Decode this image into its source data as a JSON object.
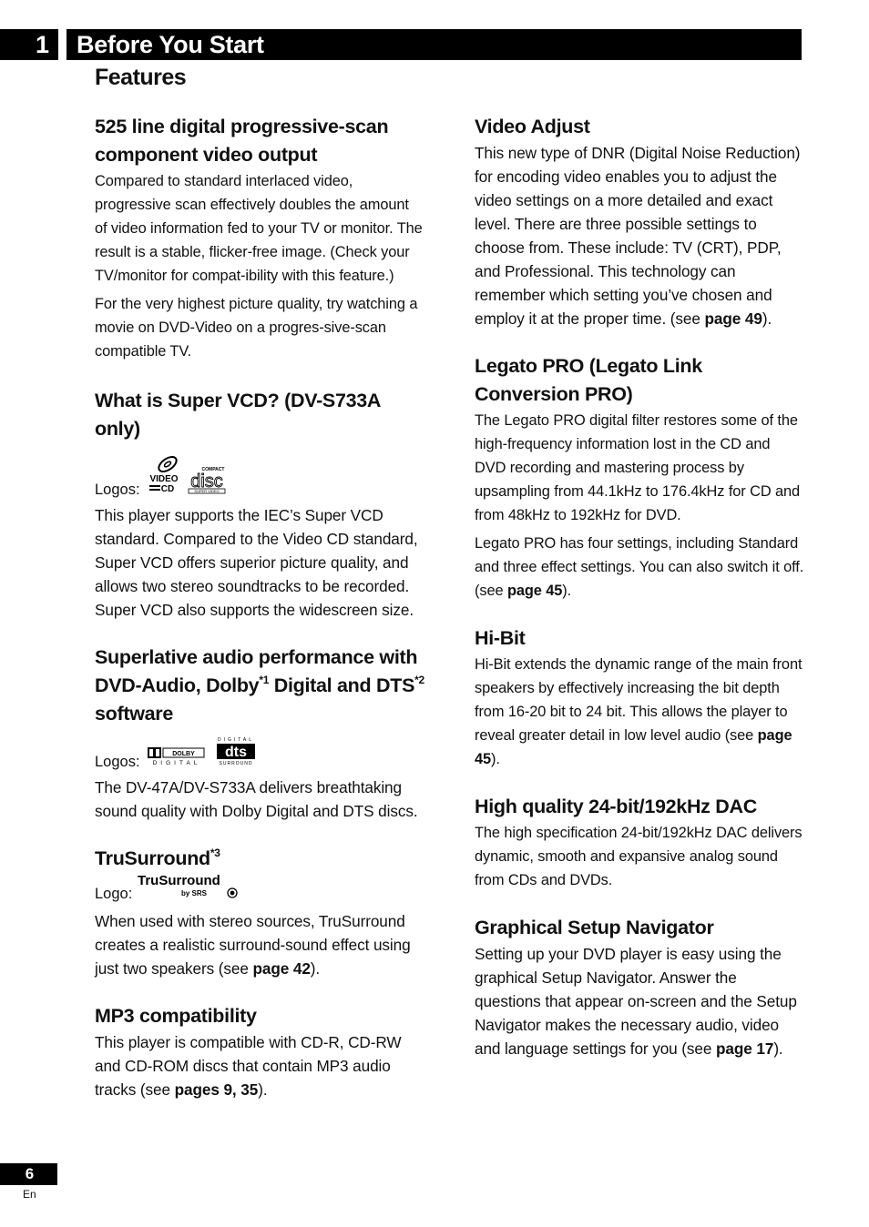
{
  "header": {
    "chapter_number": "1",
    "chapter_title": "Before You Start",
    "page_title": "Features"
  },
  "left_column": {
    "progressive": {
      "heading": "525 line digital progressive-scan component video output",
      "para1": "Compared to standard interlaced video, progressive scan effectively doubles the amount of video information fed to your TV or monitor. The result is a stable, flicker-free image. (Check your TV/monitor for compat-ibility with this feature.)",
      "para2": "For the very highest picture quality, try watching a movie on DVD-Video on a progres-sive-scan compatible TV."
    },
    "svcd": {
      "heading": "What is Super VCD? (DV-S733A only)",
      "logos_label": "Logos:",
      "logos": [
        "video-cd-logo",
        "compact-disc-super-video-logo"
      ],
      "body": "This player supports the IEC’s Super VCD standard.  Compared to the Video CD standard, Super VCD offers superior picture quality, and allows two stereo soundtracks to be recorded. Super VCD also supports the widescreen size."
    },
    "audio": {
      "heading_part1": "Superlative audio performance with DVD-Audio, Dolby",
      "heading_sup1": "*1",
      "heading_part2": " Digital and DTS",
      "heading_sup2": "*2",
      "heading_part3": " software",
      "logos_label": "Logos:",
      "logos": [
        "dolby-digital-logo",
        "dts-digital-surround-logo"
      ],
      "dolby_text": "DOLBY",
      "dolby_sub": "DIGITAL",
      "dts_top": "DIGITAL",
      "dts_mid": "dts",
      "dts_bottom": "SURROUND",
      "body": "The DV-47A/DV-S733A delivers breathtaking sound quality with Dolby Digital and DTS discs."
    },
    "trusurround": {
      "heading": "TruSurround",
      "heading_sup": "*3",
      "logo_label": "Logo:",
      "logo_main": "TruSurround",
      "logo_sub": "by SRS",
      "body_before": "When used with stereo sources, TruSurround creates a realistic surround-sound effect using just two speakers (see ",
      "body_ref": "page 42",
      "body_after": ")."
    },
    "mp3": {
      "heading": "MP3 compatibility",
      "body_before": "This player is compatible with CD-R, CD-RW and CD-ROM discs that contain MP3 audio tracks (see ",
      "body_ref": "pages 9, 35",
      "body_after": ")."
    }
  },
  "right_column": {
    "video_adjust": {
      "heading": "Video Adjust",
      "body_before": "This new type of DNR (Digital Noise Reduction) for encoding video enables you to adjust the video settings on a more detailed and exact level. There are three possible settings to choose from. These include: TV (CRT), PDP, and Professional. This technology can remember which setting you’ve chosen and employ it at the proper time. (see ",
      "body_ref": "page 49",
      "body_after": ")."
    },
    "legato": {
      "heading": "Legato PRO (Legato Link Conversion PRO)",
      "para1": "The Legato PRO digital filter restores some of the high-frequency information lost in the CD and DVD recording and mastering process by upsampling from 44.1kHz to 176.4kHz for CD and from 48kHz to 192kHz for DVD.",
      "para2_before": "Legato PRO has four settings, including Standard and three effect settings. You can also switch it off. (see ",
      "para2_ref": "page 45",
      "para2_after": ")."
    },
    "hibit": {
      "heading": "Hi-Bit",
      "body_before": "Hi-Bit extends the dynamic range of the main front speakers by effectively increasing the bit depth from 16-20 bit to 24 bit. This allows the player to reveal greater detail in low level audio (see ",
      "body_ref": "page 45",
      "body_after": ")."
    },
    "dac": {
      "heading": "High quality 24-bit/192kHz DAC",
      "body": "The high specification 24-bit/192kHz DAC delivers dynamic, smooth and expansive analog sound from CDs and DVDs."
    },
    "navigator": {
      "heading": "Graphical Setup Navigator",
      "body_before": "Setting up your DVD player is easy using the graphical Setup Navigator.  Answer the questions that appear on-screen and the Setup Navigator makes the necessary audio, video and language settings for you (see ",
      "body_ref": "page 17",
      "body_after": ")."
    }
  },
  "footer": {
    "page_number": "6",
    "language": "En"
  }
}
